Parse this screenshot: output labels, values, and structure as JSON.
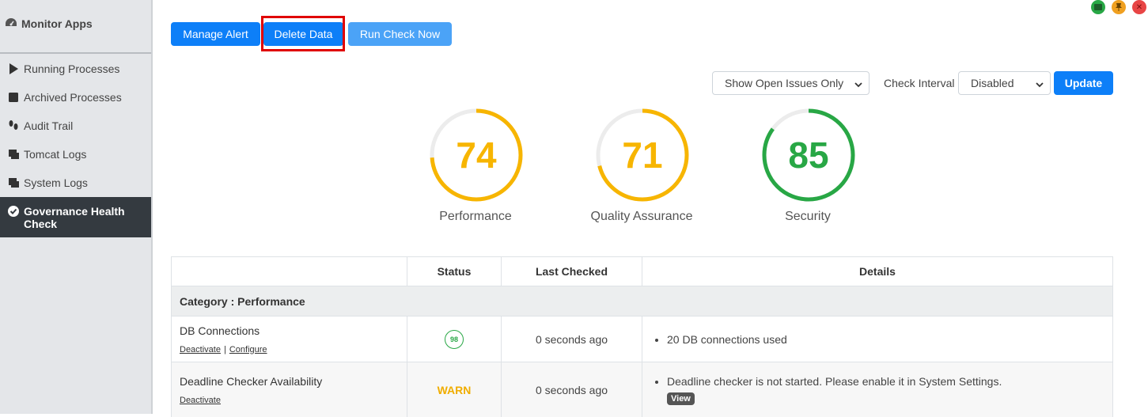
{
  "sidebar": {
    "title": "Monitor Apps",
    "items": [
      {
        "label": "Running Processes",
        "icon": "play-icon"
      },
      {
        "label": "Archived Processes",
        "icon": "square-icon"
      },
      {
        "label": "Audit Trail",
        "icon": "footsteps-icon"
      },
      {
        "label": "Tomcat Logs",
        "icon": "log-icon"
      },
      {
        "label": "System Logs",
        "icon": "log-icon"
      },
      {
        "label": "Governance Health Check",
        "icon": "check-circle-icon",
        "active": true
      }
    ]
  },
  "toolbar": {
    "manage_alert": "Manage Alert",
    "delete_data": "Delete Data",
    "run_check": "Run Check Now"
  },
  "filters": {
    "issues_select": "Show Open Issues Only",
    "interval_label": "Check Interval",
    "interval_select": "Disabled",
    "update": "Update"
  },
  "gauges": [
    {
      "label": "Performance",
      "value": "74",
      "percent": 74,
      "color": "#f7b500"
    },
    {
      "label": "Quality Assurance",
      "value": "71",
      "percent": 71,
      "color": "#f7b500"
    },
    {
      "label": "Security",
      "value": "85",
      "percent": 85,
      "color": "#28a745"
    }
  ],
  "table": {
    "headers": [
      "",
      "Status",
      "Last Checked",
      "Details"
    ],
    "category": "Category : Performance",
    "rows": [
      {
        "name": "DB Connections",
        "links": [
          "Deactivate",
          "Configure"
        ],
        "status": "98",
        "last_checked": "0 seconds ago",
        "detail": "20 DB connections used"
      },
      {
        "name": "Deadline Checker Availability",
        "links": [
          "Deactivate"
        ],
        "status": "WARN",
        "last_checked": "0 seconds ago",
        "detail": "Deadline checker is not started. Please enable it in System Settings.",
        "detail_button": "View"
      }
    ]
  },
  "colors": {
    "primary": "#0d7ff8",
    "primary_light": "#4ba3f7",
    "highlight": "#e00000",
    "sidebar_active": "#343a40"
  }
}
